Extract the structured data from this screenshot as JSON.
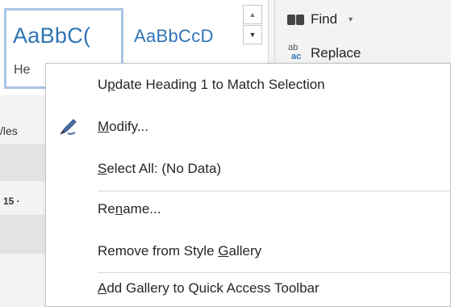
{
  "ribbon": {
    "styles_gallery": {
      "tiles": [
        {
          "sample": "AaBbC(",
          "name": "He",
          "selected": true
        },
        {
          "sample": "AaBbCcD",
          "name": "",
          "selected": false
        }
      ],
      "scroll_up_icon": "triangle-up-icon",
      "scroll_down_icon": "triangle-down-icon"
    },
    "editing": {
      "find_label": "Find",
      "find_caret": "▾",
      "replace_label": "Replace",
      "replace_icon_top": "ab",
      "replace_icon_bottom": "ac"
    }
  },
  "left_strip": {
    "label": "/les",
    "number": "15 ·"
  },
  "context_menu": {
    "items": [
      {
        "pre": "U",
        "key": "p",
        "post": "date Heading 1 to Match Selection"
      },
      {
        "pre": "",
        "key": "M",
        "post": "odify...",
        "icon": "pencil-brush-icon"
      },
      {
        "pre": "",
        "key": "S",
        "post": "elect All: (No Data)"
      },
      {
        "pre": "Re",
        "key": "n",
        "post": "ame..."
      },
      {
        "pre": "Remove from Style ",
        "key": "G",
        "post": "allery"
      },
      {
        "pre": "",
        "key": "A",
        "post": "dd Gallery to Quick Access Toolbar"
      }
    ]
  },
  "colors": {
    "accent": "#2e74b5",
    "selected_tile_border": "#a9c4e4",
    "ribbon_bg": "#f3f3f3"
  }
}
